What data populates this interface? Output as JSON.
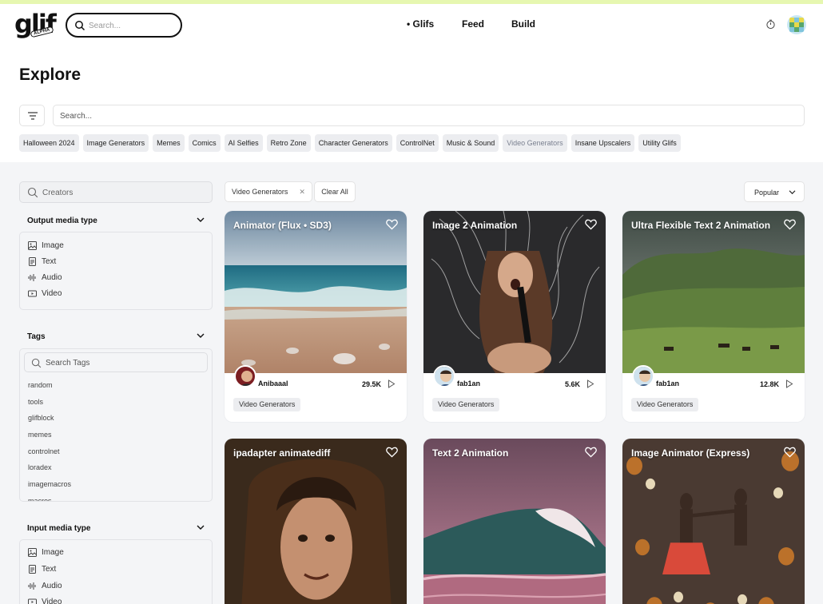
{
  "header": {
    "logo_text": "glif",
    "logo_badge": "ALPHA",
    "search_placeholder": "Search...",
    "nav": {
      "glifs": "• Glifs",
      "feed": "Feed",
      "build": "Build"
    }
  },
  "explore": {
    "title": "Explore",
    "search_placeholder": "Search...",
    "tag_chips": [
      "Halloween 2024",
      "Image Generators",
      "Memes",
      "Comics",
      "AI Selfies",
      "Retro Zone",
      "Character Generators",
      "ControlNet",
      "Music & Sound",
      "Video Generators",
      "Insane Upscalers",
      "Utility Glifs"
    ],
    "active_chip": "Video Generators"
  },
  "sidebar": {
    "creators_placeholder": "Creators",
    "output_media": {
      "title": "Output media type",
      "items": [
        "Image",
        "Text",
        "Audio",
        "Video"
      ]
    },
    "tags": {
      "title": "Tags",
      "search_placeholder": "Search Tags",
      "items": [
        "random",
        "tools",
        "glifblock",
        "memes",
        "controlnet",
        "loradex",
        "imagemacros",
        "macros"
      ]
    },
    "input_media": {
      "title": "Input media type",
      "items": [
        "Image",
        "Text",
        "Audio",
        "Video"
      ]
    }
  },
  "filters": {
    "active": "Video Generators",
    "clear_label": "Clear All",
    "sort_label": "Popular"
  },
  "cards": [
    {
      "title": "Animator (Flux • SD3)",
      "author": "Anibaaal",
      "runs": "29.5K",
      "tag": "Video Generators"
    },
    {
      "title": "Image 2 Animation",
      "author": "fab1an",
      "runs": "5.6K",
      "tag": "Video Generators"
    },
    {
      "title": "Ultra Flexible Text 2 Animation",
      "author": "fab1an",
      "runs": "12.8K",
      "tag": "Video Generators"
    },
    {
      "title": "ipadapter animatediff"
    },
    {
      "title": "Text 2 Animation"
    },
    {
      "title": "Image Animator (Express)"
    }
  ],
  "colors": {
    "topline": "#e6f7b0",
    "lower_bg": "#f4f5f7",
    "chip_bg": "#ecedf0"
  }
}
